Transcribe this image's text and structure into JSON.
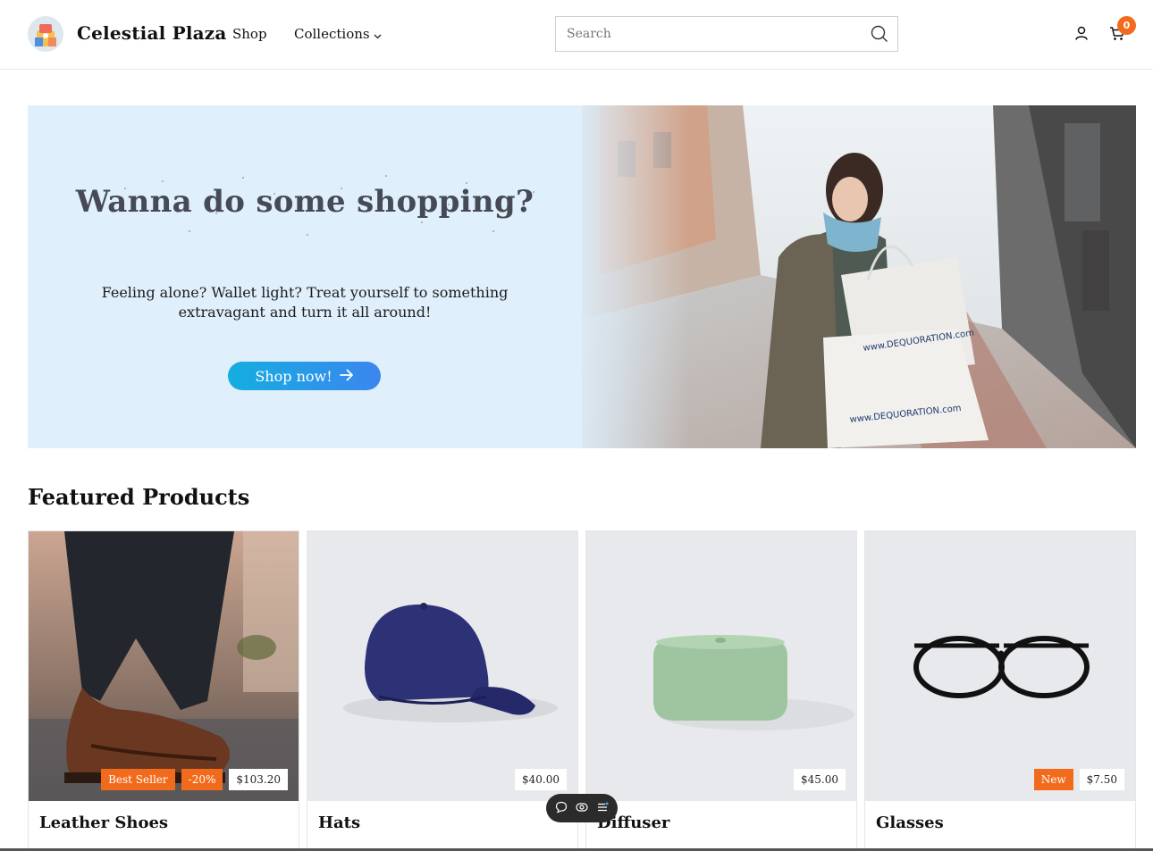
{
  "header": {
    "brand": "Celestial Plaza",
    "nav": {
      "shop": "Shop",
      "collections": "Collections"
    },
    "search": {
      "placeholder": "Search"
    },
    "cart_count": "0"
  },
  "hero": {
    "title": "Wanna do some shopping?",
    "subtitle": "Feeling alone? Wallet light? Treat yourself to something extravagant and turn it all around!",
    "button_label": "Shop now!",
    "bag_print": "www.DEQUORATION.com"
  },
  "featured": {
    "title": "Featured Products",
    "products": [
      {
        "name": "Leather Shoes",
        "tags": [
          "Best Seller",
          "-20%"
        ],
        "price": "$103.20"
      },
      {
        "name": "Hats",
        "tags": [],
        "price": "$40.00"
      },
      {
        "name": "Diffuser",
        "tags": [],
        "price": "$45.00"
      },
      {
        "name": "Glasses",
        "tags": [
          "New"
        ],
        "price": "$7.50"
      }
    ]
  },
  "icons": {
    "search": "search-icon",
    "user": "user-icon",
    "cart": "cart-icon",
    "chevron": "chevron-down-icon",
    "arrow": "arrow-right-icon",
    "toolbar": [
      "comment-icon",
      "eye-icon",
      "list-icon"
    ]
  },
  "colors": {
    "accent": "#f26b1d",
    "hero_bg": "#dfeffb",
    "button_start": "#15aee0",
    "button_end": "#3b86ef"
  }
}
